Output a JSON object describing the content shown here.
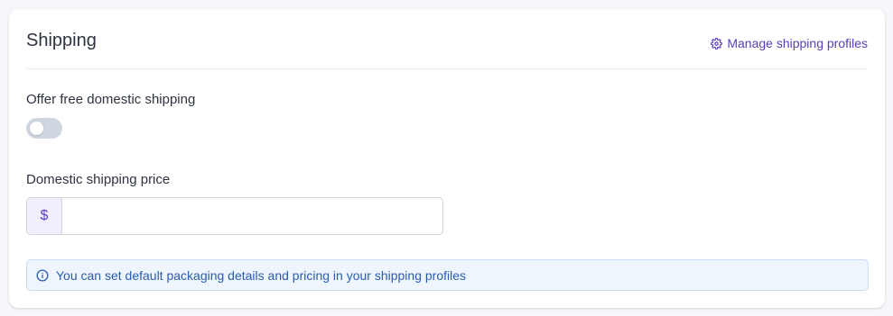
{
  "card": {
    "title": "Shipping",
    "manage_link": {
      "label": "Manage shipping profiles",
      "icon": "gear-icon"
    }
  },
  "free_shipping": {
    "label": "Offer free domestic shipping",
    "enabled": false
  },
  "price": {
    "label": "Domestic shipping price",
    "currency_symbol": "$",
    "value": "",
    "placeholder": ""
  },
  "info": {
    "icon": "info-icon",
    "text": "You can set default packaging details and pricing in your shipping profiles"
  },
  "colors": {
    "accent": "#5b3cc4",
    "info_text": "#2a5db0",
    "info_bg": "#eef5fd",
    "toggle_off": "#cfd6e0"
  }
}
